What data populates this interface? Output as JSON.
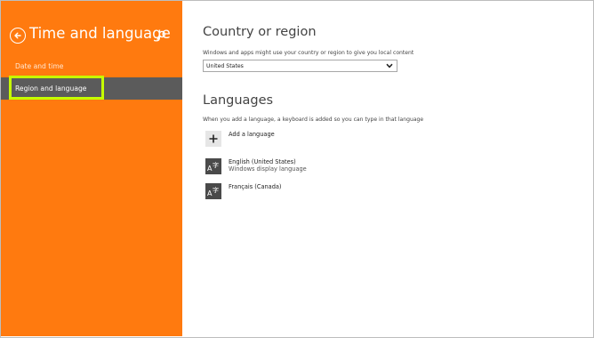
{
  "sidebar": {
    "title": "Time and language",
    "items": [
      {
        "label": "Date and time"
      },
      {
        "label": "Region and language"
      }
    ]
  },
  "region": {
    "heading": "Country or region",
    "description": "Windows and apps might use your country or region to give you local content",
    "selected": "United States"
  },
  "languages": {
    "heading": "Languages",
    "description": "When you add a language, a keyboard is added so you can type in that language",
    "add_label": "Add a language",
    "items": [
      {
        "name": "English (United States)",
        "sub": "Windows display language"
      },
      {
        "name": "Français (Canada)",
        "sub": ""
      }
    ]
  },
  "colors": {
    "accent": "#ff7a0f",
    "selected_nav": "#5b5b5b",
    "highlight": "#c6ff00"
  },
  "icons": {
    "back": "back-arrow-icon",
    "search": "search-icon",
    "add": "plus-icon",
    "language": "language-glyph-icon",
    "dropdown": "chevron-down-icon"
  }
}
